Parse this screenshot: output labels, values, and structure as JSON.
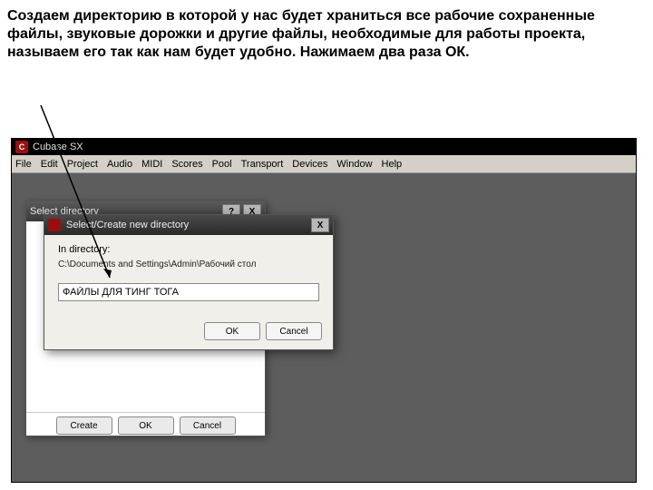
{
  "instruction_text": "Создаем директорию в которой у нас будет храниться все рабочие сохраненные файлы, звуковые дорожки и другие файлы, необходимые для работы проекта, называем его так как нам будет удобно. Нажимаем два раза ОК.",
  "app": {
    "logo_letter": "C",
    "title": "Cubase SX"
  },
  "menu": {
    "items": [
      "File",
      "Edit",
      "Project",
      "Audio",
      "MIDI",
      "Scores",
      "Pool",
      "Transport",
      "Devices",
      "Window",
      "Help"
    ]
  },
  "dialog_outer": {
    "title": "Select directory",
    "help_glyph": "?",
    "close_glyph": "X",
    "buttons": {
      "create": "Create",
      "ok": "OK",
      "cancel": "Cancel"
    }
  },
  "dialog_inner": {
    "title": "Select/Create new directory",
    "close_glyph": "X",
    "in_directory_label": "In directory:",
    "path": "C:\\Documents and Settings\\Admin\\Рабочий стол",
    "input_value": "ФАЙЛЫ ДЛЯ ТИНГ ТОГА",
    "buttons": {
      "ok": "OK",
      "cancel": "Cancel"
    }
  }
}
